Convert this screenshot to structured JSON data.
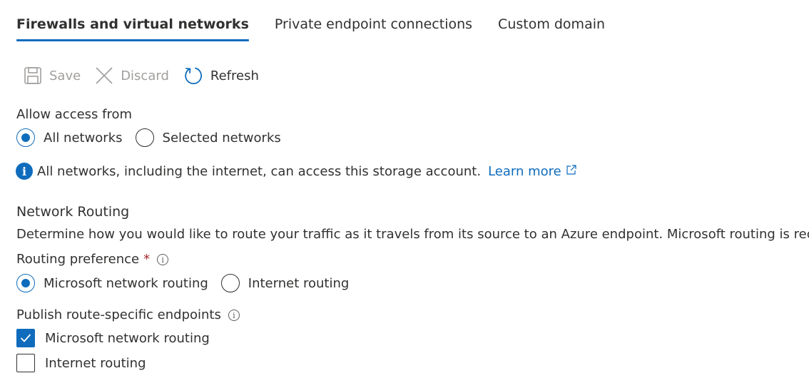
{
  "tabs": [
    {
      "label": "Firewalls and virtual networks",
      "active": true
    },
    {
      "label": "Private endpoint connections",
      "active": false
    },
    {
      "label": "Custom domain",
      "active": false
    }
  ],
  "toolbar": {
    "save_label": "Save",
    "discard_label": "Discard",
    "refresh_label": "Refresh",
    "save_icon": "save-icon",
    "discard_icon": "close-icon",
    "refresh_icon": "refresh-icon"
  },
  "access": {
    "label": "Allow access from",
    "options": [
      {
        "label": "All networks",
        "selected": true
      },
      {
        "label": "Selected networks",
        "selected": false
      }
    ],
    "info_text": "All networks, including the internet, can access this storage account.",
    "learn_more": "Learn more"
  },
  "routing": {
    "heading": "Network Routing",
    "description": "Determine how you would like to route your traffic as it travels from its source to an Azure endpoint. Microsoft routing is recommended for most customers.",
    "preference_label": "Routing preference",
    "required_mark": "*",
    "preference_options": [
      {
        "label": "Microsoft network routing",
        "selected": true
      },
      {
        "label": "Internet routing",
        "selected": false
      }
    ],
    "publish_label": "Publish route-specific endpoints",
    "publish_options": [
      {
        "label": "Microsoft network routing",
        "checked": true
      },
      {
        "label": "Internet routing",
        "checked": false
      }
    ]
  },
  "colors": {
    "accent": "#0f6cbd",
    "text": "#323130",
    "disabled": "#a19f9d",
    "required": "#a4262c"
  }
}
